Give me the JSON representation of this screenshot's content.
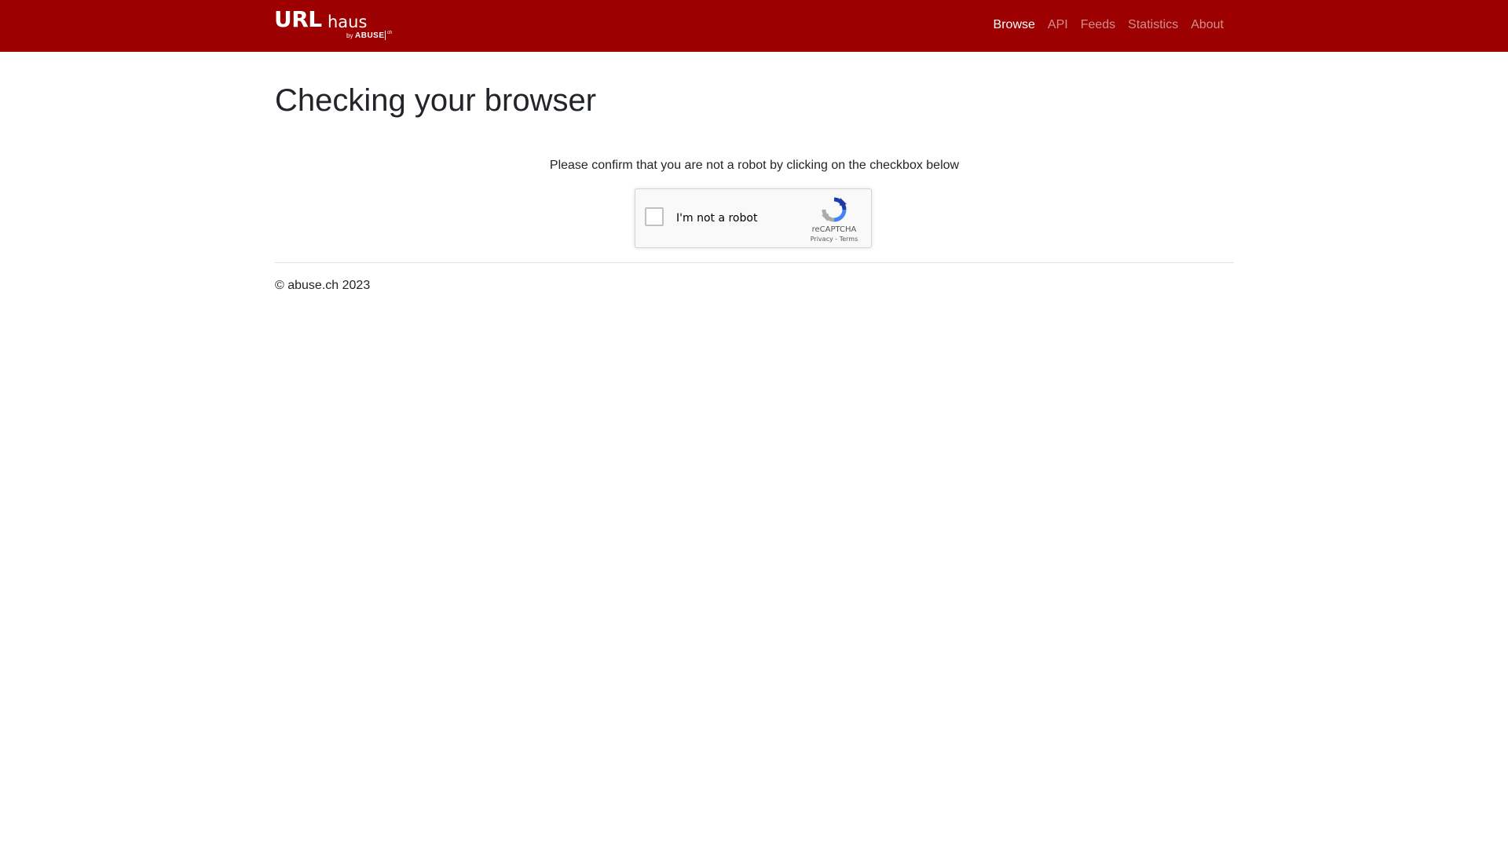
{
  "header": {
    "brand": {
      "main": "URL",
      "suffix": "haus",
      "by": "by",
      "org": "ABUSE",
      "org_tld": "ch"
    },
    "nav": [
      {
        "label": "Browse",
        "active": true
      },
      {
        "label": "API",
        "active": false
      },
      {
        "label": "Feeds",
        "active": false
      },
      {
        "label": "Statistics",
        "active": false
      },
      {
        "label": "About",
        "active": false
      }
    ]
  },
  "main": {
    "title": "Checking your browser",
    "prompt": "Please confirm that you are not a robot by clicking on the checkbox below"
  },
  "recaptcha": {
    "label": "I'm not a robot",
    "brand": "reCAPTCHA",
    "privacy": "Privacy",
    "separator": " - ",
    "terms": "Terms",
    "checked": false
  },
  "footer": {
    "copyright": "© abuse.ch 2023"
  },
  "colors": {
    "navbar": "#9d0000",
    "nav_active": "#ffffff",
    "nav_inactive": "rgba(255,255,255,0.55)"
  },
  "icons": {
    "recaptcha_logo": "recaptcha-logo-icon"
  }
}
